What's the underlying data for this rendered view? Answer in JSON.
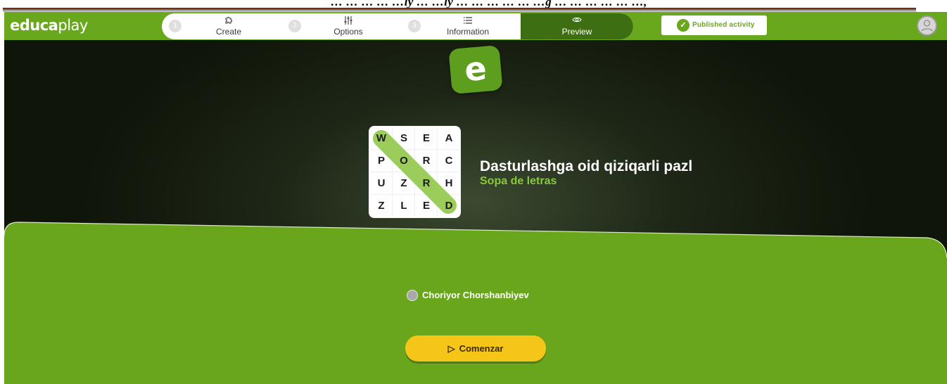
{
  "document": {
    "header_fragment": "… … … … …ly … …ly … … … … … …g … … … … … …,"
  },
  "app": {
    "logo": {
      "bold": "educa",
      "light": "play"
    },
    "steps": [
      {
        "num": "1",
        "icon": "puzzle-icon",
        "glyph": "⚙",
        "label": "Create"
      },
      {
        "num": "2",
        "icon": "sliders-icon",
        "glyph": "⫶",
        "label": "Options"
      },
      {
        "num": "3",
        "icon": "list-icon",
        "glyph": "☰",
        "label": "Information"
      },
      {
        "icon": "eye-icon",
        "glyph": "◉",
        "label": "Preview"
      }
    ],
    "published_label": "Published activity",
    "colors": {
      "brand": "#69a81c",
      "preview_tab": "#3d6e12",
      "button": "#f5c518",
      "subtitle": "#86c93c"
    }
  },
  "activity": {
    "badge_letter": "e",
    "grid": [
      [
        "W",
        "S",
        "E",
        "A"
      ],
      [
        "P",
        "O",
        "R",
        "C"
      ],
      [
        "U",
        "Z",
        "R",
        "H"
      ],
      [
        "Z",
        "L",
        "E",
        "D"
      ]
    ],
    "highlighted_word": "WORD",
    "title": "Dasturlashga oid qiziqarli pazl",
    "type": "Sopa de letras",
    "author": "Choriyor Chorshanbiyev",
    "start_label": "Comenzar"
  }
}
